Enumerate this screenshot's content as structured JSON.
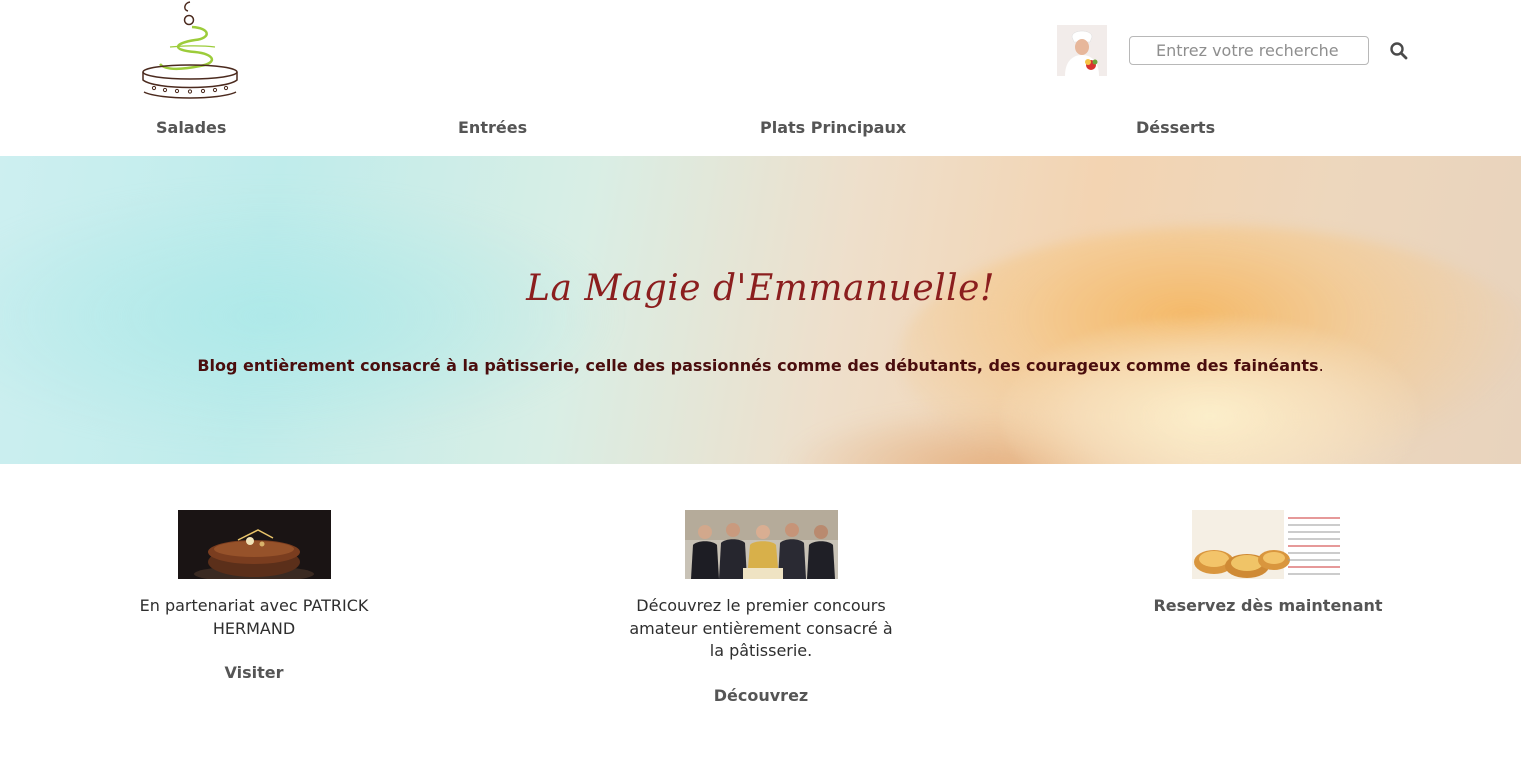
{
  "header": {
    "logo_name": "cake-logo",
    "avatar_name": "chef-avatar",
    "search": {
      "placeholder": "Entrez votre recherche",
      "value": ""
    },
    "search_button_icon": "search-icon"
  },
  "nav": {
    "items": [
      {
        "label": "Salades"
      },
      {
        "label": "Entrées"
      },
      {
        "label": "Plats Principaux"
      },
      {
        "label": "Désserts"
      }
    ]
  },
  "hero": {
    "title": "La Magie d'Emmanuelle!",
    "description": "Blog entièrement consacré à la pâtisserie, celle des passionnés comme des débutants, des courageux comme des fainéants",
    "description_end": "."
  },
  "cards": [
    {
      "image": "chocolate-cake-image",
      "text": "En partenariat avec PATRICK HERMAND",
      "link": "Visiter"
    },
    {
      "image": "contest-jury-image",
      "text": "Découvrez le premier concours amateur entièrement consacré à la pâtisserie.",
      "link": "Découvrez"
    },
    {
      "image": "portugal-paris-image",
      "text": "Reservez dès maintenant",
      "link": ""
    }
  ],
  "colors": {
    "nav_text": "#555555",
    "hero_title": "#8b1e1e",
    "hero_text": "#4a0d0d",
    "logo_green": "#9ccc3a",
    "logo_brown": "#4b2a1e"
  }
}
